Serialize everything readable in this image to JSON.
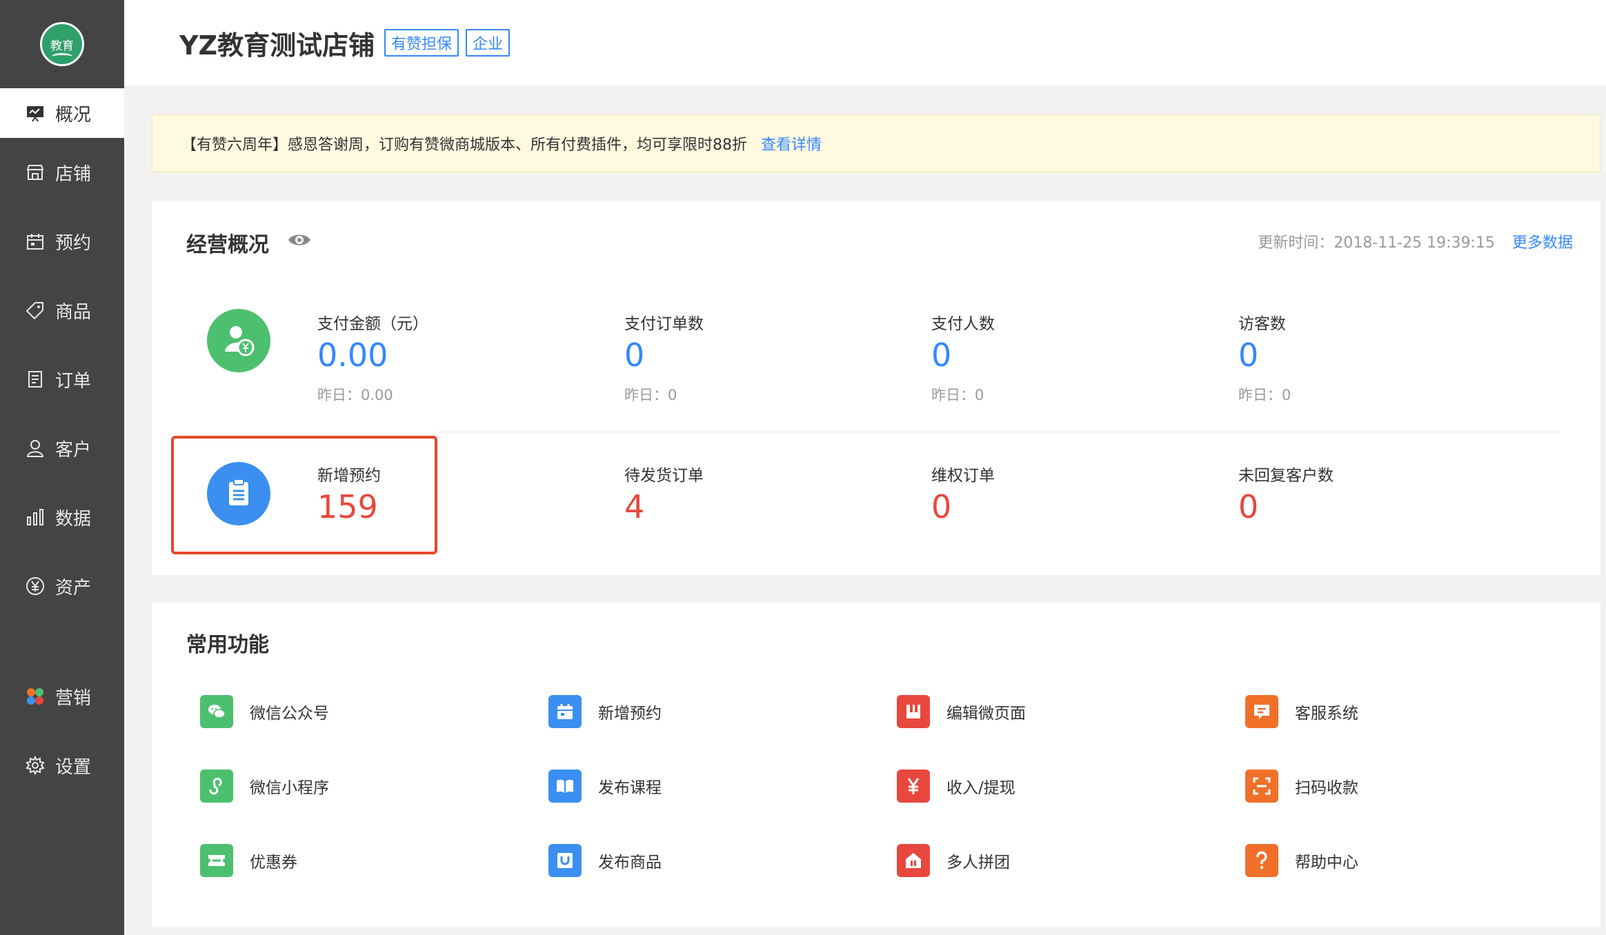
{
  "logo": {
    "text": "教育"
  },
  "nav": [
    {
      "label": "概况",
      "icon": "overview-icon"
    },
    {
      "label": "店铺",
      "icon": "shop-icon"
    },
    {
      "label": "预约",
      "icon": "calendar-icon"
    },
    {
      "label": "商品",
      "icon": "tag-icon"
    },
    {
      "label": "订单",
      "icon": "order-icon"
    },
    {
      "label": "客户",
      "icon": "user-icon"
    },
    {
      "label": "数据",
      "icon": "bar-chart-icon"
    },
    {
      "label": "资产",
      "icon": "yen-icon"
    },
    {
      "label": "营销",
      "icon": "marketing-icon"
    },
    {
      "label": "设置",
      "icon": "gear-icon"
    }
  ],
  "header": {
    "title": "YZ教育测试店铺",
    "tags": [
      "有赞担保",
      "企业"
    ]
  },
  "notice": {
    "text": "【有赞六周年】感恩答谢周，订购有赞微商城版本、所有付费插件，均可享限时88折",
    "link": "查看详情"
  },
  "overview": {
    "title": "经营概况",
    "update_label": "更新时间：",
    "update_time": "2018-11-25 19:39:15",
    "more": "更多数据",
    "row1": [
      {
        "label": "支付金额（元）",
        "value": "0.00",
        "yest": "昨日：0.00"
      },
      {
        "label": "支付订单数",
        "value": "0",
        "yest": "昨日：0"
      },
      {
        "label": "支付人数",
        "value": "0",
        "yest": "昨日：0"
      },
      {
        "label": "访客数",
        "value": "0",
        "yest": "昨日：0"
      }
    ],
    "row2": [
      {
        "label": "新增预约",
        "value": "159"
      },
      {
        "label": "待发货订单",
        "value": "4"
      },
      {
        "label": "维权订单",
        "value": "0"
      },
      {
        "label": "未回复客户数",
        "value": "0"
      }
    ]
  },
  "functions": {
    "title": "常用功能",
    "items": [
      {
        "label": "微信公众号",
        "icon": "wechat-icon",
        "color": "#4cc06e"
      },
      {
        "label": "新增预约",
        "icon": "calendar-icon",
        "color": "#3a8ff0"
      },
      {
        "label": "编辑微页面",
        "icon": "page-edit-icon",
        "color": "#e8473d"
      },
      {
        "label": "客服系统",
        "icon": "chat-icon",
        "color": "#f0702a"
      },
      {
        "label": "微信小程序",
        "icon": "mini-program-icon",
        "color": "#4cc06e"
      },
      {
        "label": "发布课程",
        "icon": "book-icon",
        "color": "#3a8ff0"
      },
      {
        "label": "收入/提现",
        "icon": "yen-icon",
        "color": "#e8473d"
      },
      {
        "label": "扫码收款",
        "icon": "scan-icon",
        "color": "#f0702a"
      },
      {
        "label": "优惠券",
        "icon": "coupon-icon",
        "color": "#4cc06e"
      },
      {
        "label": "发布商品",
        "icon": "bag-icon",
        "color": "#3a8ff0"
      },
      {
        "label": "多人拼团",
        "icon": "group-buy-icon",
        "color": "#e8473d"
      },
      {
        "label": "帮助中心",
        "icon": "help-icon",
        "color": "#f0702a"
      }
    ]
  }
}
